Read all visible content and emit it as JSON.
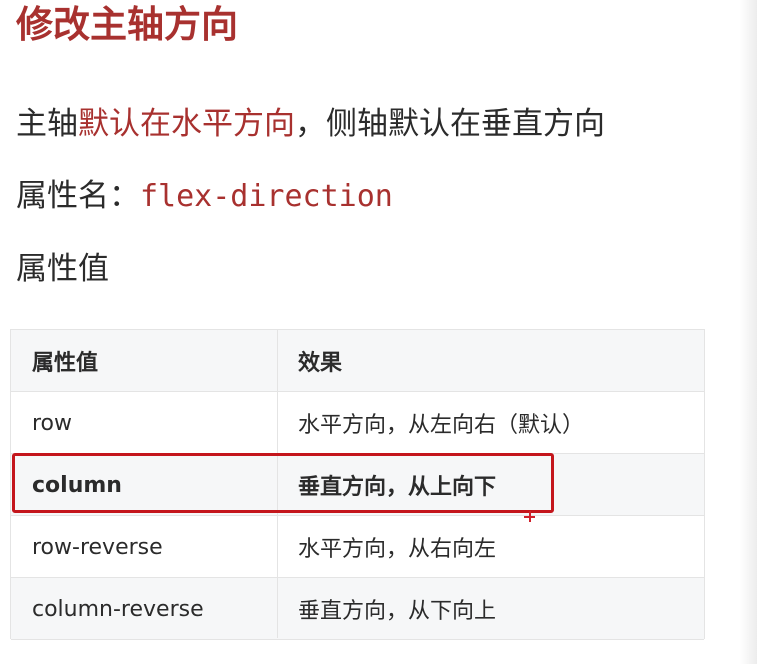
{
  "title": "修改主轴方向",
  "lines": {
    "line1": {
      "prefix": "主轴",
      "highlight": "默认在水平方向",
      "suffix": "，侧轴默认在垂直方向"
    },
    "line2": {
      "label": "属性名：",
      "code": "flex-direction"
    },
    "line3": "属性值"
  },
  "table": {
    "headers": [
      "属性值",
      "效果"
    ],
    "rows": [
      {
        "value": "row",
        "effect": "水平方向，从左向右（默认）"
      },
      {
        "value": "column",
        "effect": "垂直方向，从上向下"
      },
      {
        "value": "row-reverse",
        "effect": "水平方向，从右向左"
      },
      {
        "value": "column-reverse",
        "effect": "垂直方向，从下向上"
      }
    ]
  },
  "colors": {
    "accent": "#a8312f",
    "highlight_box": "#c4161c"
  }
}
